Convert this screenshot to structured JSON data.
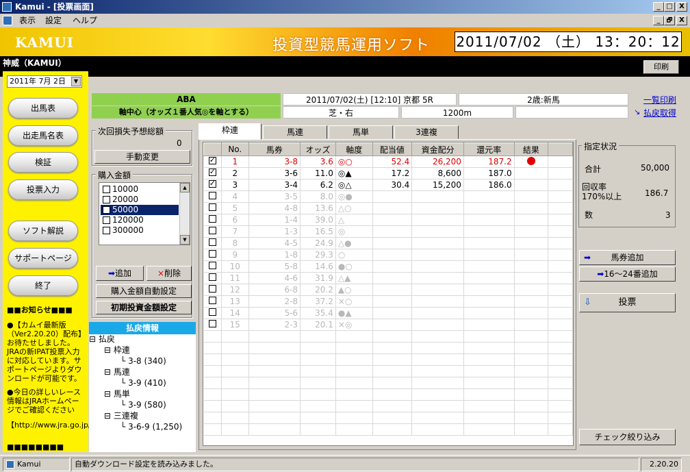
{
  "window": {
    "title": "Kamui - [投票画面]",
    "min": "_",
    "max": "□",
    "close": "X",
    "inner_min": "_",
    "inner_max": "🗗",
    "inner_close": "X"
  },
  "menu": [
    "表示",
    "設定",
    "ヘルプ"
  ],
  "banner": {
    "logo": "KAMUI",
    "subtitle": "投資型競馬運用ソフト",
    "clock": "2011/07/02 （土） 13：20：12"
  },
  "header": {
    "app_name": "神威（KAMUI）",
    "print": "印刷"
  },
  "left": {
    "date": "2011年 7月 2日",
    "buttons": [
      "出馬表",
      "出走馬名表",
      "検証",
      "投票入力",
      "ソフト解説",
      "サポートページ",
      "終了"
    ],
    "notice_title": "■■お知らせ■■■",
    "notice_1": "●【カムイ最新版（Ver2.20.20）配布】お待たせしました。JRAの新IPAT投票入力に対応しています。サポートページよりダウンロードが可能です。",
    "notice_2": "●今日の詳しいレース情報はJRAホームページでご確認ください",
    "notice_url": "【http://www.jra.go.jp/】",
    "notice_end": "■■■■■■■■"
  },
  "race": {
    "strategy": "ABA",
    "strategy_desc": "軸中心（オッズ１番人気◎を軸とする）",
    "datetime": "2011/07/02(土) [12:10]  京都 5R",
    "class": "2歳:新馬",
    "surface": "芝・右",
    "distance": "1200m",
    "link_print": "一覧印刷",
    "link_payout": "払戻取得"
  },
  "loss": {
    "label": "次回損失予想総額",
    "value": "0",
    "manual": "手動変更"
  },
  "purchase": {
    "label": "購入金額",
    "items": [
      {
        "label": "10000",
        "checked": false
      },
      {
        "label": "20000",
        "checked": false
      },
      {
        "label": "50000",
        "checked": true
      },
      {
        "label": "120000",
        "checked": false
      },
      {
        "label": "300000",
        "checked": false
      }
    ],
    "add": "追加",
    "del": "削除",
    "auto": "購入金額自動設定",
    "initial": "初期投資金額設定"
  },
  "payout": {
    "title": "払戻情報",
    "root": "払戻",
    "groups": [
      {
        "name": "枠連",
        "value": "3-8 (340)"
      },
      {
        "name": "馬連",
        "value": "3-9 (410)"
      },
      {
        "name": "馬単",
        "value": "3-9 (580)"
      },
      {
        "name": "三連複",
        "value": "3-6-9 (1,250)"
      }
    ]
  },
  "tabs": [
    "枠連",
    "馬連",
    "馬単",
    "3連複"
  ],
  "table": {
    "headers": [
      "No.",
      "馬券",
      "オッズ",
      "軸度",
      "配当値",
      "資金配分",
      "還元率",
      "結果"
    ],
    "rows": [
      {
        "no": "1",
        "ticket": "3-8",
        "odds": "3.6",
        "axis": "◎○",
        "payout": "52.4",
        "fund": "26,200",
        "rate": "187.2",
        "result": "hit",
        "checked": true,
        "style": "red"
      },
      {
        "no": "2",
        "ticket": "3-6",
        "odds": "11.0",
        "axis": "◎▲",
        "payout": "17.2",
        "fund": "8,600",
        "rate": "187.0",
        "result": "",
        "checked": true,
        "style": "normal"
      },
      {
        "no": "3",
        "ticket": "3-4",
        "odds": "6.2",
        "axis": "◎△",
        "payout": "30.4",
        "fund": "15,200",
        "rate": "186.0",
        "result": "",
        "checked": true,
        "style": "normal"
      },
      {
        "no": "4",
        "ticket": "3-5",
        "odds": "8.0",
        "axis": "◎●",
        "checked": false,
        "style": "dim"
      },
      {
        "no": "5",
        "ticket": "4-8",
        "odds": "13.6",
        "axis": "△○",
        "checked": false,
        "style": "dim"
      },
      {
        "no": "6",
        "ticket": "1-4",
        "odds": "39.0",
        "axis": "△",
        "checked": false,
        "style": "dim"
      },
      {
        "no": "7",
        "ticket": "1-3",
        "odds": "16.5",
        "axis": "◎",
        "checked": false,
        "style": "dim"
      },
      {
        "no": "8",
        "ticket": "4-5",
        "odds": "24.9",
        "axis": "△●",
        "checked": false,
        "style": "dim"
      },
      {
        "no": "9",
        "ticket": "1-8",
        "odds": "29.3",
        "axis": "○",
        "checked": false,
        "style": "dim"
      },
      {
        "no": "10",
        "ticket": "5-8",
        "odds": "14.6",
        "axis": "●○",
        "checked": false,
        "style": "dim"
      },
      {
        "no": "11",
        "ticket": "4-6",
        "odds": "31.9",
        "axis": "△▲",
        "checked": false,
        "style": "dim"
      },
      {
        "no": "12",
        "ticket": "6-8",
        "odds": "20.2",
        "axis": "▲○",
        "checked": false,
        "style": "dim"
      },
      {
        "no": "13",
        "ticket": "2-8",
        "odds": "37.2",
        "axis": "×○",
        "checked": false,
        "style": "dim"
      },
      {
        "no": "14",
        "ticket": "5-6",
        "odds": "35.4",
        "axis": "●▲",
        "checked": false,
        "style": "dim"
      },
      {
        "no": "15",
        "ticket": "2-3",
        "odds": "20.1",
        "axis": "×◎",
        "checked": false,
        "style": "dim"
      }
    ]
  },
  "status_box": {
    "label": "指定状況",
    "total_label": "合計",
    "total": "50,000",
    "recovery_label": "回収率",
    "recovery_sub": "170%以上",
    "recovery": "186.7",
    "count_label": "数",
    "count": "3"
  },
  "actions": {
    "add_ticket": "馬券追加",
    "add_16_24": "16〜24番追加",
    "vote": "投票",
    "check_filter": "チェック絞り込み"
  },
  "statusbar": {
    "app": "Kamui",
    "message": "自動ダウンロード設定を読み込みました。",
    "version": "2.20.20"
  }
}
